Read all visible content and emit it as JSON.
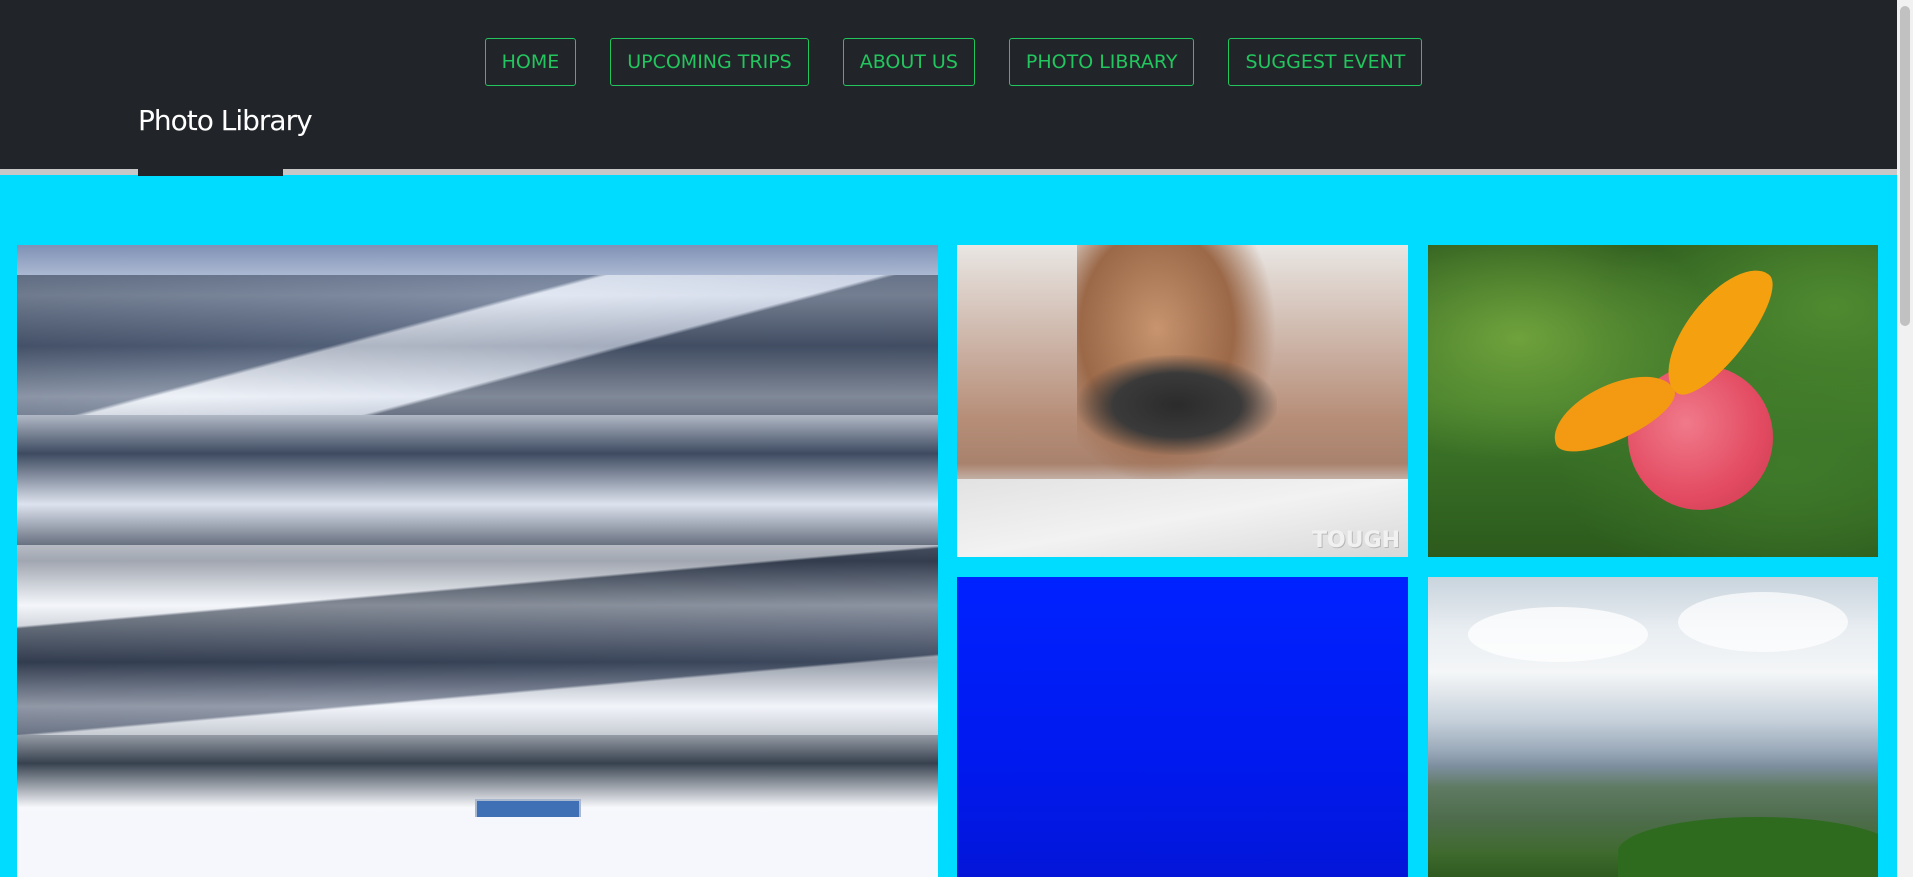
{
  "nav": {
    "items": [
      {
        "label": "HOME"
      },
      {
        "label": "UPCOMING TRIPS"
      },
      {
        "label": "ABOUT US"
      },
      {
        "label": "PHOTO LIBRARY"
      },
      {
        "label": "SUGGEST EVENT"
      }
    ]
  },
  "header": {
    "title": "Photo Library"
  },
  "gallery": {
    "photos": [
      {
        "subject": "snowy ski slopes"
      },
      {
        "subject": "mud run athlete",
        "overlay_text": "TOUGH"
      },
      {
        "subject": "orange butterfly on pink ball"
      },
      {
        "subject": "solid blue image"
      },
      {
        "subject": "green valley landscape"
      }
    ]
  },
  "colors": {
    "header_bg": "#212529",
    "nav_accent": "#22c55e",
    "page_bg": "#00dcff",
    "title_text": "#ffffff"
  }
}
